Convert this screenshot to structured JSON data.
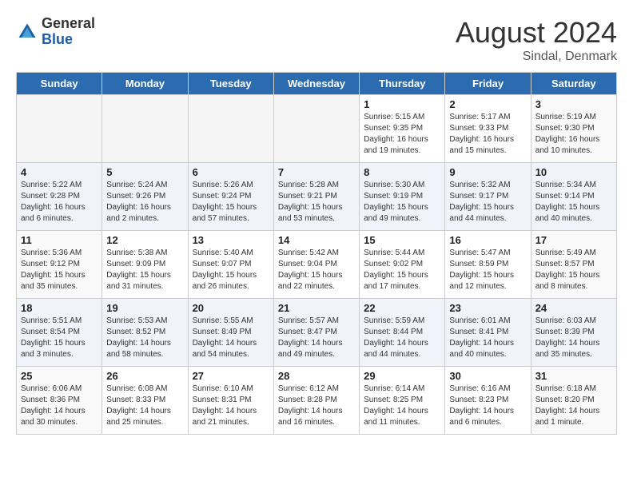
{
  "logo": {
    "general": "General",
    "blue": "Blue"
  },
  "title": {
    "month_year": "August 2024",
    "location": "Sindal, Denmark"
  },
  "days_of_week": [
    "Sunday",
    "Monday",
    "Tuesday",
    "Wednesday",
    "Thursday",
    "Friday",
    "Saturday"
  ],
  "weeks": [
    [
      {
        "day": "",
        "empty": true
      },
      {
        "day": "",
        "empty": true
      },
      {
        "day": "",
        "empty": true
      },
      {
        "day": "",
        "empty": true
      },
      {
        "day": "1",
        "sunrise": "Sunrise: 5:15 AM",
        "sunset": "Sunset: 9:35 PM",
        "daylight": "Daylight: 16 hours and 19 minutes."
      },
      {
        "day": "2",
        "sunrise": "Sunrise: 5:17 AM",
        "sunset": "Sunset: 9:33 PM",
        "daylight": "Daylight: 16 hours and 15 minutes."
      },
      {
        "day": "3",
        "sunrise": "Sunrise: 5:19 AM",
        "sunset": "Sunset: 9:30 PM",
        "daylight": "Daylight: 16 hours and 10 minutes."
      }
    ],
    [
      {
        "day": "4",
        "sunrise": "Sunrise: 5:22 AM",
        "sunset": "Sunset: 9:28 PM",
        "daylight": "Daylight: 16 hours and 6 minutes."
      },
      {
        "day": "5",
        "sunrise": "Sunrise: 5:24 AM",
        "sunset": "Sunset: 9:26 PM",
        "daylight": "Daylight: 16 hours and 2 minutes."
      },
      {
        "day": "6",
        "sunrise": "Sunrise: 5:26 AM",
        "sunset": "Sunset: 9:24 PM",
        "daylight": "Daylight: 15 hours and 57 minutes."
      },
      {
        "day": "7",
        "sunrise": "Sunrise: 5:28 AM",
        "sunset": "Sunset: 9:21 PM",
        "daylight": "Daylight: 15 hours and 53 minutes."
      },
      {
        "day": "8",
        "sunrise": "Sunrise: 5:30 AM",
        "sunset": "Sunset: 9:19 PM",
        "daylight": "Daylight: 15 hours and 49 minutes."
      },
      {
        "day": "9",
        "sunrise": "Sunrise: 5:32 AM",
        "sunset": "Sunset: 9:17 PM",
        "daylight": "Daylight: 15 hours and 44 minutes."
      },
      {
        "day": "10",
        "sunrise": "Sunrise: 5:34 AM",
        "sunset": "Sunset: 9:14 PM",
        "daylight": "Daylight: 15 hours and 40 minutes."
      }
    ],
    [
      {
        "day": "11",
        "sunrise": "Sunrise: 5:36 AM",
        "sunset": "Sunset: 9:12 PM",
        "daylight": "Daylight: 15 hours and 35 minutes."
      },
      {
        "day": "12",
        "sunrise": "Sunrise: 5:38 AM",
        "sunset": "Sunset: 9:09 PM",
        "daylight": "Daylight: 15 hours and 31 minutes."
      },
      {
        "day": "13",
        "sunrise": "Sunrise: 5:40 AM",
        "sunset": "Sunset: 9:07 PM",
        "daylight": "Daylight: 15 hours and 26 minutes."
      },
      {
        "day": "14",
        "sunrise": "Sunrise: 5:42 AM",
        "sunset": "Sunset: 9:04 PM",
        "daylight": "Daylight: 15 hours and 22 minutes."
      },
      {
        "day": "15",
        "sunrise": "Sunrise: 5:44 AM",
        "sunset": "Sunset: 9:02 PM",
        "daylight": "Daylight: 15 hours and 17 minutes."
      },
      {
        "day": "16",
        "sunrise": "Sunrise: 5:47 AM",
        "sunset": "Sunset: 8:59 PM",
        "daylight": "Daylight: 15 hours and 12 minutes."
      },
      {
        "day": "17",
        "sunrise": "Sunrise: 5:49 AM",
        "sunset": "Sunset: 8:57 PM",
        "daylight": "Daylight: 15 hours and 8 minutes."
      }
    ],
    [
      {
        "day": "18",
        "sunrise": "Sunrise: 5:51 AM",
        "sunset": "Sunset: 8:54 PM",
        "daylight": "Daylight: 15 hours and 3 minutes."
      },
      {
        "day": "19",
        "sunrise": "Sunrise: 5:53 AM",
        "sunset": "Sunset: 8:52 PM",
        "daylight": "Daylight: 14 hours and 58 minutes."
      },
      {
        "day": "20",
        "sunrise": "Sunrise: 5:55 AM",
        "sunset": "Sunset: 8:49 PM",
        "daylight": "Daylight: 14 hours and 54 minutes."
      },
      {
        "day": "21",
        "sunrise": "Sunrise: 5:57 AM",
        "sunset": "Sunset: 8:47 PM",
        "daylight": "Daylight: 14 hours and 49 minutes."
      },
      {
        "day": "22",
        "sunrise": "Sunrise: 5:59 AM",
        "sunset": "Sunset: 8:44 PM",
        "daylight": "Daylight: 14 hours and 44 minutes."
      },
      {
        "day": "23",
        "sunrise": "Sunrise: 6:01 AM",
        "sunset": "Sunset: 8:41 PM",
        "daylight": "Daylight: 14 hours and 40 minutes."
      },
      {
        "day": "24",
        "sunrise": "Sunrise: 6:03 AM",
        "sunset": "Sunset: 8:39 PM",
        "daylight": "Daylight: 14 hours and 35 minutes."
      }
    ],
    [
      {
        "day": "25",
        "sunrise": "Sunrise: 6:06 AM",
        "sunset": "Sunset: 8:36 PM",
        "daylight": "Daylight: 14 hours and 30 minutes."
      },
      {
        "day": "26",
        "sunrise": "Sunrise: 6:08 AM",
        "sunset": "Sunset: 8:33 PM",
        "daylight": "Daylight: 14 hours and 25 minutes."
      },
      {
        "day": "27",
        "sunrise": "Sunrise: 6:10 AM",
        "sunset": "Sunset: 8:31 PM",
        "daylight": "Daylight: 14 hours and 21 minutes."
      },
      {
        "day": "28",
        "sunrise": "Sunrise: 6:12 AM",
        "sunset": "Sunset: 8:28 PM",
        "daylight": "Daylight: 14 hours and 16 minutes."
      },
      {
        "day": "29",
        "sunrise": "Sunrise: 6:14 AM",
        "sunset": "Sunset: 8:25 PM",
        "daylight": "Daylight: 14 hours and 11 minutes."
      },
      {
        "day": "30",
        "sunrise": "Sunrise: 6:16 AM",
        "sunset": "Sunset: 8:23 PM",
        "daylight": "Daylight: 14 hours and 6 minutes."
      },
      {
        "day": "31",
        "sunrise": "Sunrise: 6:18 AM",
        "sunset": "Sunset: 8:20 PM",
        "daylight": "Daylight: 14 hours and 1 minute."
      }
    ]
  ]
}
